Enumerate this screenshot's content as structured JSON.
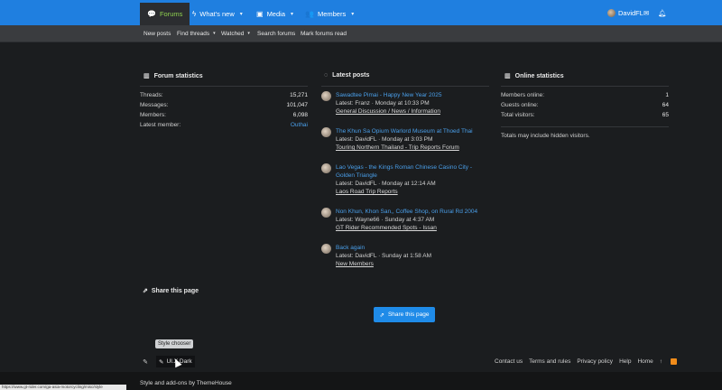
{
  "nav": {
    "tabs": [
      {
        "label": "Forums",
        "icon": "chat-icon"
      },
      {
        "label": "What's new",
        "icon": "bolt-icon"
      },
      {
        "label": "Media",
        "icon": "image-icon"
      },
      {
        "label": "Members",
        "icon": "users-icon"
      }
    ],
    "user": "DavidFL"
  },
  "subnav": {
    "items": [
      "New posts",
      "Find threads",
      "Watched",
      "Search forums",
      "Mark forums read"
    ]
  },
  "forum_stats": {
    "title": "Forum statistics",
    "rows": [
      {
        "label": "Threads:",
        "value": "15,271"
      },
      {
        "label": "Messages:",
        "value": "101,047"
      },
      {
        "label": "Members:",
        "value": "6,098"
      },
      {
        "label": "Latest member:",
        "value": "Outhai"
      }
    ]
  },
  "latest_posts": {
    "title": "Latest posts",
    "posts": [
      {
        "title": "Sawadtee Pimai - Happy New Year 2025",
        "meta": "Latest: Franz · Monday at 10:33 PM",
        "forum": "General Discussion / News / Information"
      },
      {
        "title": "The Khun Sa Opium Warlord Museum at Thoed Thai",
        "meta": "Latest: DavidFL · Monday at 3:03 PM",
        "forum": "Touring Northern Thailand - Trip Reports Forum"
      },
      {
        "title": "Lao Vegas - the Kings Roman Chinese Casino City - Golden Triangle",
        "meta": "Latest: DavidFL · Monday at 12:14 AM",
        "forum": "Laos Road Trip Reports"
      },
      {
        "title": "Non Khun, Khon San,, Coffee Shop, on Rural Rd 2004",
        "meta": "Latest: Wayne66 · Sunday at 4:37 AM",
        "forum": "GT Rider Recommended Spots - Issan"
      },
      {
        "title": "Back again",
        "meta": "Latest: DavidFL · Sunday at 1:58 AM",
        "forum": "New Members"
      }
    ]
  },
  "online_stats": {
    "title": "Online statistics",
    "rows": [
      {
        "label": "Members online:",
        "value": "1"
      },
      {
        "label": "Guests online:",
        "value": "64"
      },
      {
        "label": "Total visitors:",
        "value": "65"
      }
    ],
    "note": "Totals may include hidden visitors."
  },
  "share": {
    "heading": "Share this page",
    "button": "Share this page"
  },
  "footer": {
    "tooltip": "Style chooser",
    "style_name": "UI.X Dark",
    "links": [
      "Contact us",
      "Terms and rules",
      "Privacy policy",
      "Help",
      "Home"
    ],
    "credit": "Style and add-ons by ThemeHouse",
    "status_url": "https://www.gt-rider.com/ga-asia-motorcycling/misc/style"
  },
  "colors": {
    "brand": "#1f7fe0",
    "link": "#4a9fea",
    "active_tab_text": "#8fd14f"
  }
}
